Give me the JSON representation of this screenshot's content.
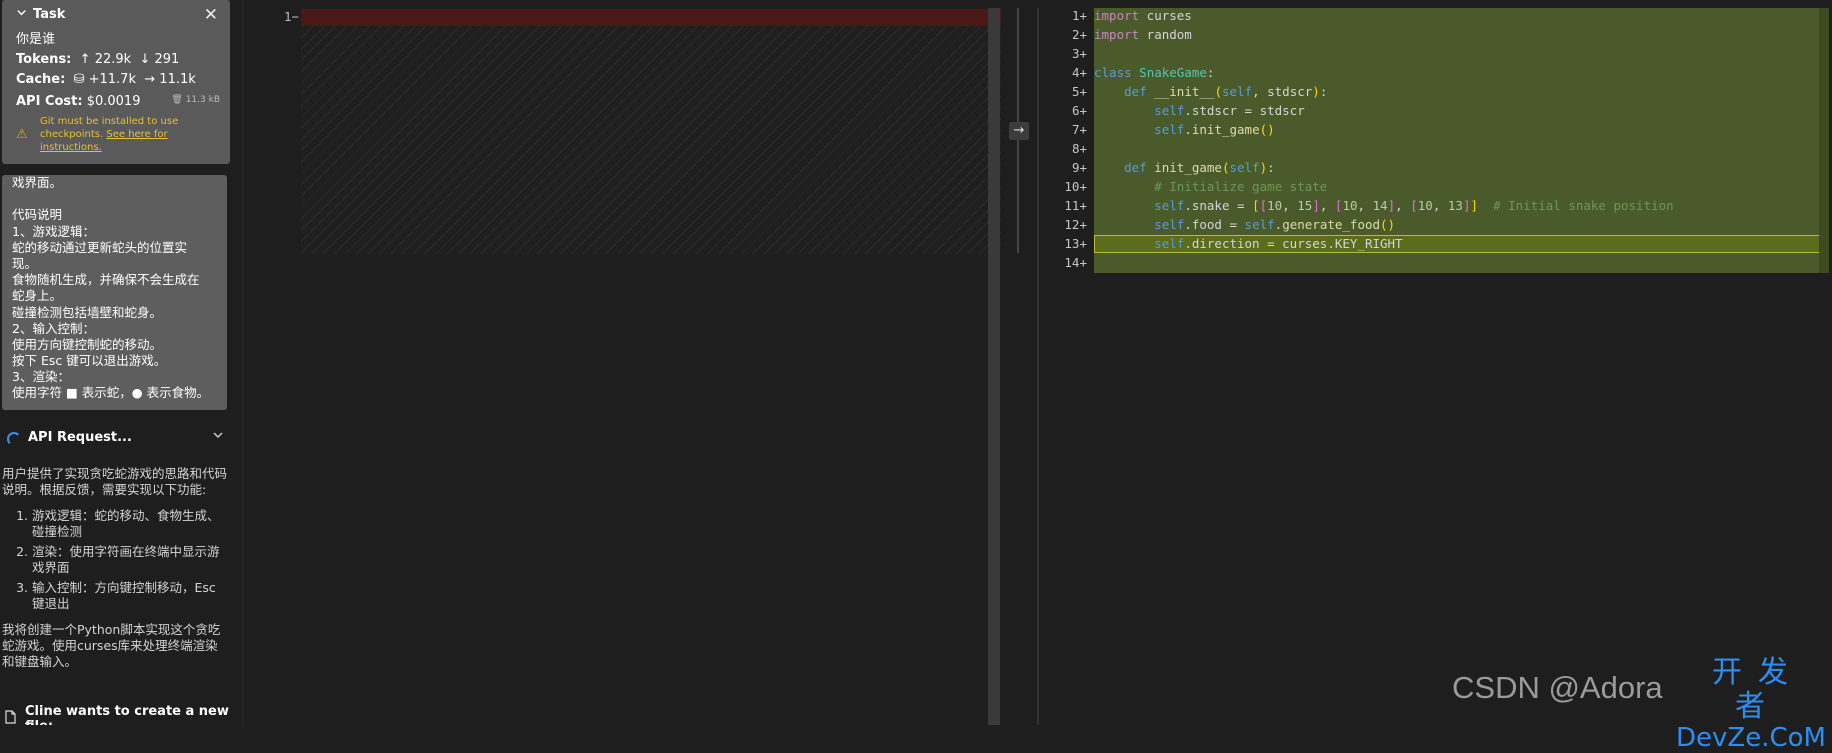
{
  "task": {
    "title": "Task",
    "question": "你是谁",
    "tokens_label": "Tokens:",
    "tokens_in": "22.9k",
    "tokens_out": "291",
    "cache_label": "Cache:",
    "cache_write": "+11.7k",
    "cache_read": "11.1k",
    "cost_label": "API Cost:",
    "cost_value": "$0.0019",
    "size": "11.3 kB",
    "warning_text": "Git must be installed to use checkpoints.",
    "warning_link": "See here for instructions."
  },
  "message_lines": [
    "戏界面。",
    "",
    "代码说明",
    "1、游戏逻辑：",
    "蛇的移动通过更新蛇头的位置实",
    "现。",
    "食物随机生成，并确保不会生成在",
    "蛇身上。",
    "碰撞检测包括墙壁和蛇身。",
    "2、输入控制：",
    "使用方向键控制蛇的移动。",
    "按下 Esc 键可以退出游戏。",
    "3、渲染：",
    "使用字符 ■ 表示蛇，● 表示食物。"
  ],
  "api_request": {
    "label": "API Request..."
  },
  "thinking": {
    "intro": "用户提供了实现贪吃蛇游戏的思路和代码说明。根据反馈，需要实现以下功能:",
    "items": [
      "游戏逻辑：蛇的移动、食物生成、碰撞检测",
      "渲染：使用字符画在终端中显示游戏界面",
      "输入控制：方向键控制移动，Esc键退出"
    ],
    "outro": "我将创建一个Python脚本实现这个贪吃蛇游戏。使用curses库来处理终端渲染和键盘输入。"
  },
  "cline_create": "Cline wants to create a new file:",
  "left_editor": {
    "line_number": "1",
    "line_marker": "−"
  },
  "right_editor": {
    "line_numbers": [
      "1",
      "2",
      "3",
      "4",
      "5",
      "6",
      "7",
      "8",
      "9",
      "10",
      "11",
      "12",
      "13",
      "14"
    ],
    "line_marker": "+"
  },
  "watermark": {
    "text": "CSDN @Adora",
    "logo_top": "开发者",
    "logo_bottom": "DevZe.CoM"
  }
}
